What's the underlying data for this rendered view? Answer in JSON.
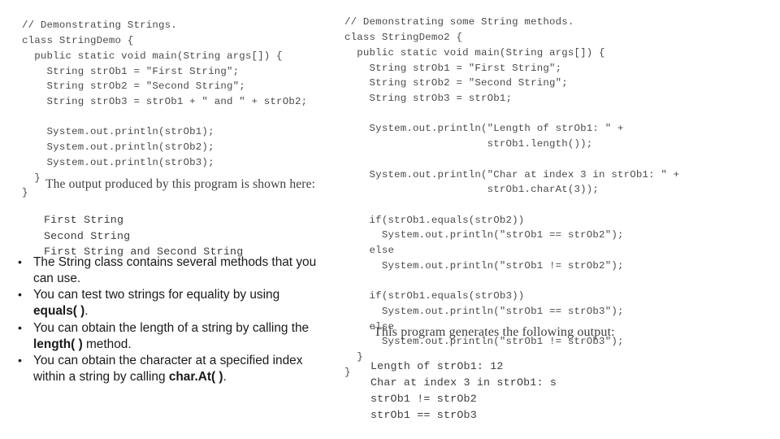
{
  "left": {
    "code": "// Demonstrating Strings.\nclass StringDemo {\n  public static void main(String args[]) {\n    String strOb1 = \"First String\";\n    String strOb2 = \"Second String\";\n    String strOb3 = strOb1 + \" and \" + strOb2;\n\n    System.out.println(strOb1);\n    System.out.println(strOb2);\n    System.out.println(strOb3);\n  }\n}",
    "output_caption": "The output produced by this program is shown here:",
    "output": "First String\nSecond String\nFirst String and Second String"
  },
  "bullets": [
    {
      "marker": "•",
      "parts": [
        {
          "text": "The String class contains several methods that you can use.",
          "bold": false
        }
      ]
    },
    {
      "marker": "•",
      "parts": [
        {
          "text": "You can test two strings for equality by using ",
          "bold": false
        },
        {
          "text": "equals( )",
          "bold": true
        },
        {
          "text": ".",
          "bold": false
        }
      ]
    },
    {
      "marker": "•",
      "parts": [
        {
          "text": "You can obtain the length of a string by calling the ",
          "bold": false
        },
        {
          "text": "length( )",
          "bold": true
        },
        {
          "text": " method.",
          "bold": false
        }
      ]
    },
    {
      "marker": "•",
      "parts": [
        {
          "text": "You can obtain the character at a specified index within a string by calling ",
          "bold": false
        },
        {
          "text": "char.At( )",
          "bold": true
        },
        {
          "text": ".",
          "bold": false
        }
      ]
    }
  ],
  "right": {
    "code": "// Demonstrating some String methods.\nclass StringDemo2 {\n  public static void main(String args[]) {\n    String strOb1 = \"First String\";\n    String strOb2 = \"Second String\";\n    String strOb3 = strOb1;\n\n    System.out.println(\"Length of strOb1: \" +\n                       strOb1.length());\n\n    System.out.println(\"Char at index 3 in strOb1: \" +\n                       strOb1.charAt(3));\n\n    if(strOb1.equals(strOb2))\n      System.out.println(\"strOb1 == strOb2\");\n    else\n      System.out.println(\"strOb1 != strOb2\");\n\n    if(strOb1.equals(strOb3))\n      System.out.println(\"strOb1 == strOb3\");\n    else\n      System.out.println(\"strOb1 != strOb3\");\n  }\n}",
    "output_caption": "This program generates the following output:",
    "output": "Length of strOb1: 12\nChar at index 3 in strOb1: s\nstrOb1 != strOb2\nstrOb1 == strOb3"
  }
}
